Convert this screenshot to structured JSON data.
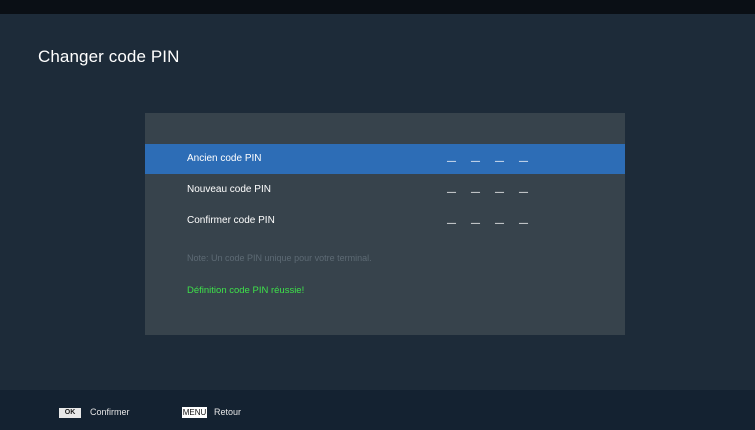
{
  "title": "Changer code PIN",
  "rows": [
    {
      "label": "Ancien code PIN",
      "value": "_ _ _ _"
    },
    {
      "label": "Nouveau code PIN",
      "value": "_ _ _ _"
    },
    {
      "label": "Confirmer code PIN",
      "value": "_ _ _ _"
    }
  ],
  "note": "Note: Un code PIN unique pour votre terminal.",
  "status": "Définition code PIN réussie!",
  "footer": {
    "ok_key": "OK",
    "ok_label": "Confirmer",
    "menu_key": "MENU",
    "menu_label": "Retour"
  },
  "colors": {
    "selection": "#2d6db6",
    "success": "#3ee14a"
  }
}
